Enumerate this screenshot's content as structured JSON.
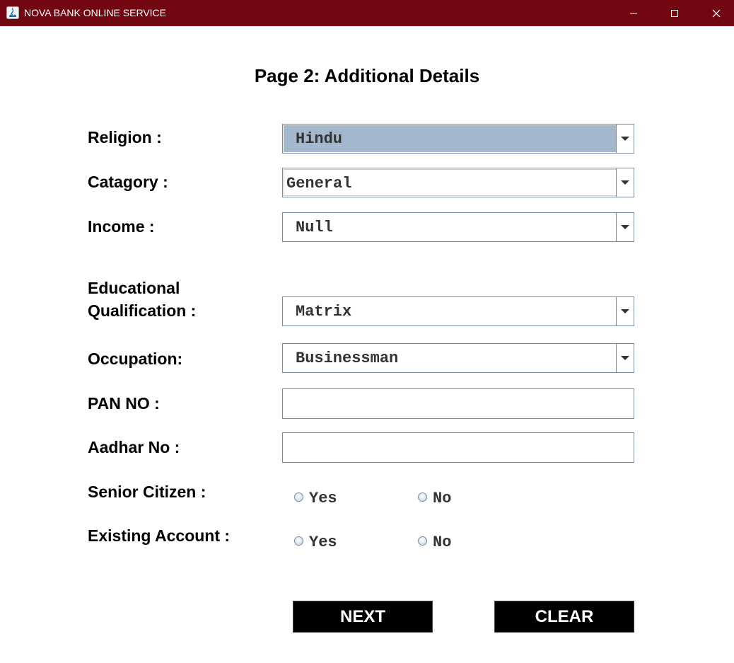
{
  "window": {
    "title": "NOVA BANK ONLINE SERVICE"
  },
  "page": {
    "heading": "Page 2: Additional Details"
  },
  "form": {
    "religion": {
      "label": "Religion :",
      "value": "Hindu"
    },
    "category": {
      "label": "Catagory :",
      "value": "General"
    },
    "income": {
      "label": "Income :",
      "value": "Null"
    },
    "education": {
      "label_line1": "Educational",
      "label_line2": "Qualification :",
      "value": "Matrix"
    },
    "occupation": {
      "label": "Occupation:",
      "value": "Businessman"
    },
    "pan": {
      "label": "PAN NO :",
      "value": ""
    },
    "aadhar": {
      "label": "Aadhar No :",
      "value": ""
    },
    "senior_citizen": {
      "label": "Senior Citizen :",
      "options": [
        "Yes",
        "No"
      ]
    },
    "existing_account": {
      "label": "Existing Account :",
      "options": [
        "Yes",
        "No"
      ]
    }
  },
  "buttons": {
    "next": "NEXT",
    "clear": "CLEAR"
  },
  "colors": {
    "titlebar": "#720611",
    "selected_combo": "#a3b8cc",
    "button_bg": "#000000"
  }
}
